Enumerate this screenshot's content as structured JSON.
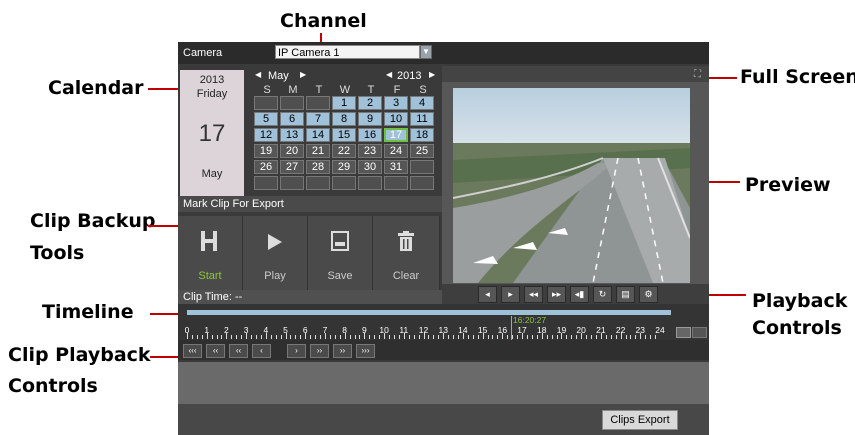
{
  "callouts": {
    "channel": "Channel",
    "calendar": "Calendar",
    "clip_backup_tools_1": "Clip Backup",
    "clip_backup_tools_2": "Tools",
    "timeline": "Timeline",
    "clip_playback_1": "Clip Playback",
    "clip_playback_2": "Controls",
    "full_screen": "Full Screen",
    "preview": "Preview",
    "playback_1": "Playback",
    "playback_2": "Controls"
  },
  "camera": {
    "label": "Camera",
    "value": "IP Camera 1"
  },
  "date_panel": {
    "year": "2013",
    "weekday": "Friday",
    "day": "17",
    "month": "May"
  },
  "calendar": {
    "month_label": "May",
    "year_label": "2013",
    "dow": [
      "S",
      "M",
      "T",
      "W",
      "T",
      "F",
      "S"
    ],
    "weeks": [
      [
        "",
        "",
        "",
        "1",
        "2",
        "3",
        "4"
      ],
      [
        "5",
        "6",
        "7",
        "8",
        "9",
        "10",
        "11"
      ],
      [
        "12",
        "13",
        "14",
        "15",
        "16",
        "17",
        "18"
      ],
      [
        "19",
        "20",
        "21",
        "22",
        "23",
        "24",
        "25"
      ],
      [
        "26",
        "27",
        "28",
        "29",
        "30",
        "31",
        ""
      ],
      [
        "",
        "",
        "",
        "",
        "",
        "",
        ""
      ]
    ],
    "recorded_days": [
      "1",
      "2",
      "3",
      "4",
      "5",
      "6",
      "7",
      "8",
      "9",
      "10",
      "11",
      "12",
      "13",
      "14",
      "15",
      "16",
      "17",
      "18"
    ],
    "selected_day": "17"
  },
  "mark_clip": {
    "title": "Mark Clip For Export",
    "tools": [
      {
        "label": "Start",
        "icon": "start-mark-icon"
      },
      {
        "label": "Play",
        "icon": "play-icon"
      },
      {
        "label": "Save",
        "icon": "save-icon"
      },
      {
        "label": "Clear",
        "icon": "trash-icon"
      }
    ]
  },
  "clip_time": {
    "label": "Clip Time: --"
  },
  "timeline": {
    "cursor_time": "16:20:27",
    "hours": [
      "0",
      "1",
      "2",
      "3",
      "4",
      "5",
      "6",
      "7",
      "8",
      "9",
      "10",
      "11",
      "12",
      "13",
      "14",
      "15",
      "16",
      "17",
      "18",
      "19",
      "20",
      "21",
      "22",
      "23",
      "24"
    ]
  },
  "clip_controls": [
    "‹‹‹",
    "‹‹",
    "‹‹",
    "‹",
    "›",
    "››",
    "››",
    "›››"
  ],
  "playback_controls": [
    "◂",
    "▸",
    "◂◂",
    "▸▸",
    "◂▮",
    "↻",
    "▤",
    "⚙"
  ],
  "buttons": {
    "clips_export": "Clips Export"
  },
  "colors": {
    "accent_green": "#8ec63f",
    "recorded_blue": "#9fc1d9",
    "callout_line": "#c00000"
  }
}
